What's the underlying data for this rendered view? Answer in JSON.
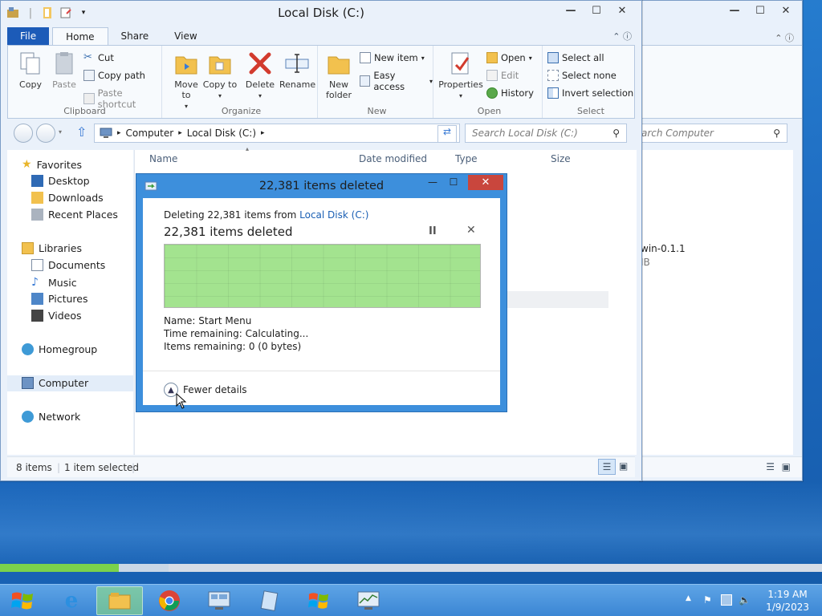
{
  "main_window": {
    "title": "Local Disk (C:)",
    "caption": {
      "minimize": "—",
      "maximize": "☐",
      "close": "✕"
    },
    "tabs": [
      "File",
      "Home",
      "Share",
      "View"
    ],
    "ribbon": {
      "clipboard": {
        "label": "Clipboard",
        "copy": "Copy",
        "paste": "Paste",
        "cut": "Cut",
        "copy_path": "Copy path",
        "paste_shortcut": "Paste shortcut"
      },
      "organize": {
        "label": "Organize",
        "move_to": "Move to",
        "copy_to": "Copy to",
        "delete": "Delete",
        "rename": "Rename"
      },
      "new": {
        "label": "New",
        "new_folder": "New folder",
        "new_item": "New item",
        "easy_access": "Easy access"
      },
      "open": {
        "label": "Open",
        "properties": "Properties",
        "open": "Open",
        "edit": "Edit",
        "history": "History"
      },
      "select": {
        "label": "Select",
        "select_all": "Select all",
        "select_none": "Select none",
        "invert_selection": "Invert selection"
      }
    },
    "address": {
      "crumbs": [
        "Computer",
        "Local Disk (C:)"
      ]
    },
    "search_placeholder": "Search Local Disk (C:)",
    "nav_pane": {
      "favorites": "Favorites",
      "desktop": "Desktop",
      "downloads": "Downloads",
      "recent_places": "Recent Places",
      "libraries": "Libraries",
      "documents": "Documents",
      "music": "Music",
      "pictures": "Pictures",
      "videos": "Videos",
      "homegroup": "Homegroup",
      "computer": "Computer",
      "network": "Network"
    },
    "columns": {
      "name": "Name",
      "date_modified": "Date modified",
      "type": "Type",
      "size": "Size"
    },
    "status": {
      "items": "8 items",
      "selected": "1 item selected"
    }
  },
  "back_window": {
    "search_placeholder": "arch Computer",
    "item_name": "win-0.1.1",
    "item_sub": "IB"
  },
  "dialog": {
    "title": "22,381 items deleted",
    "subtitle_prefix": "Deleting 22,381 items from ",
    "subtitle_link": "Local Disk (C:)",
    "status": "22,381 items deleted",
    "pause": "II",
    "cancel": "✕",
    "progress_percent": 100,
    "name_line": "Name:  Start Menu",
    "time_line": "Time remaining:  Calculating...",
    "items_line": "Items remaining:  0 (0 bytes)",
    "fewer_details": "Fewer details"
  },
  "taskbar": {
    "clock_time": "1:19 AM",
    "clock_date": "1/9/2023"
  }
}
